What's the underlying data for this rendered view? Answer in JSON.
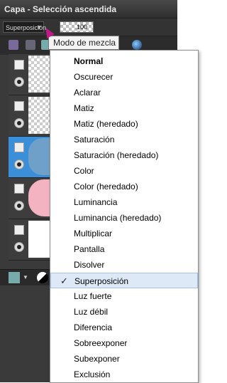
{
  "window": {
    "title": "Capa - Selección ascendida"
  },
  "toolbar": {
    "blend_mode_value": "Superposición",
    "opacity_value": "100",
    "tooltip": "Modo de mezcla",
    "icons": [
      "brush-icon",
      "mask-icon",
      "layer-icon",
      "sphere-icon"
    ]
  },
  "layers": [
    {
      "thumb": "checker"
    },
    {
      "thumb": "checker"
    },
    {
      "thumb": "blue",
      "selected": true
    },
    {
      "thumb": "pink"
    },
    {
      "thumb": "white"
    }
  ],
  "menu": {
    "items": [
      {
        "label": "Normal",
        "bold": true
      },
      {
        "label": "Oscurecer"
      },
      {
        "label": "Aclarar"
      },
      {
        "label": "Matiz"
      },
      {
        "label": "Matiz (heredado)"
      },
      {
        "label": "Saturación"
      },
      {
        "label": "Saturación (heredado)"
      },
      {
        "label": "Color"
      },
      {
        "label": "Color (heredado)"
      },
      {
        "label": "Luminancia"
      },
      {
        "label": "Luminancia (heredado)"
      },
      {
        "label": "Multiplicar"
      },
      {
        "label": "Pantalla"
      },
      {
        "label": "Disolver"
      },
      {
        "label": "Superposición",
        "checked": true,
        "hover": true
      },
      {
        "label": "Luz fuerte"
      },
      {
        "label": "Luz débil"
      },
      {
        "label": "Diferencia"
      },
      {
        "label": "Sobreexponer"
      },
      {
        "label": "Subexponer"
      },
      {
        "label": "Exclusión"
      }
    ]
  },
  "colors": {
    "selected_layer": "#3a8fd8",
    "hover_item": "#dde9f7",
    "panel": "#3a3a3a"
  }
}
